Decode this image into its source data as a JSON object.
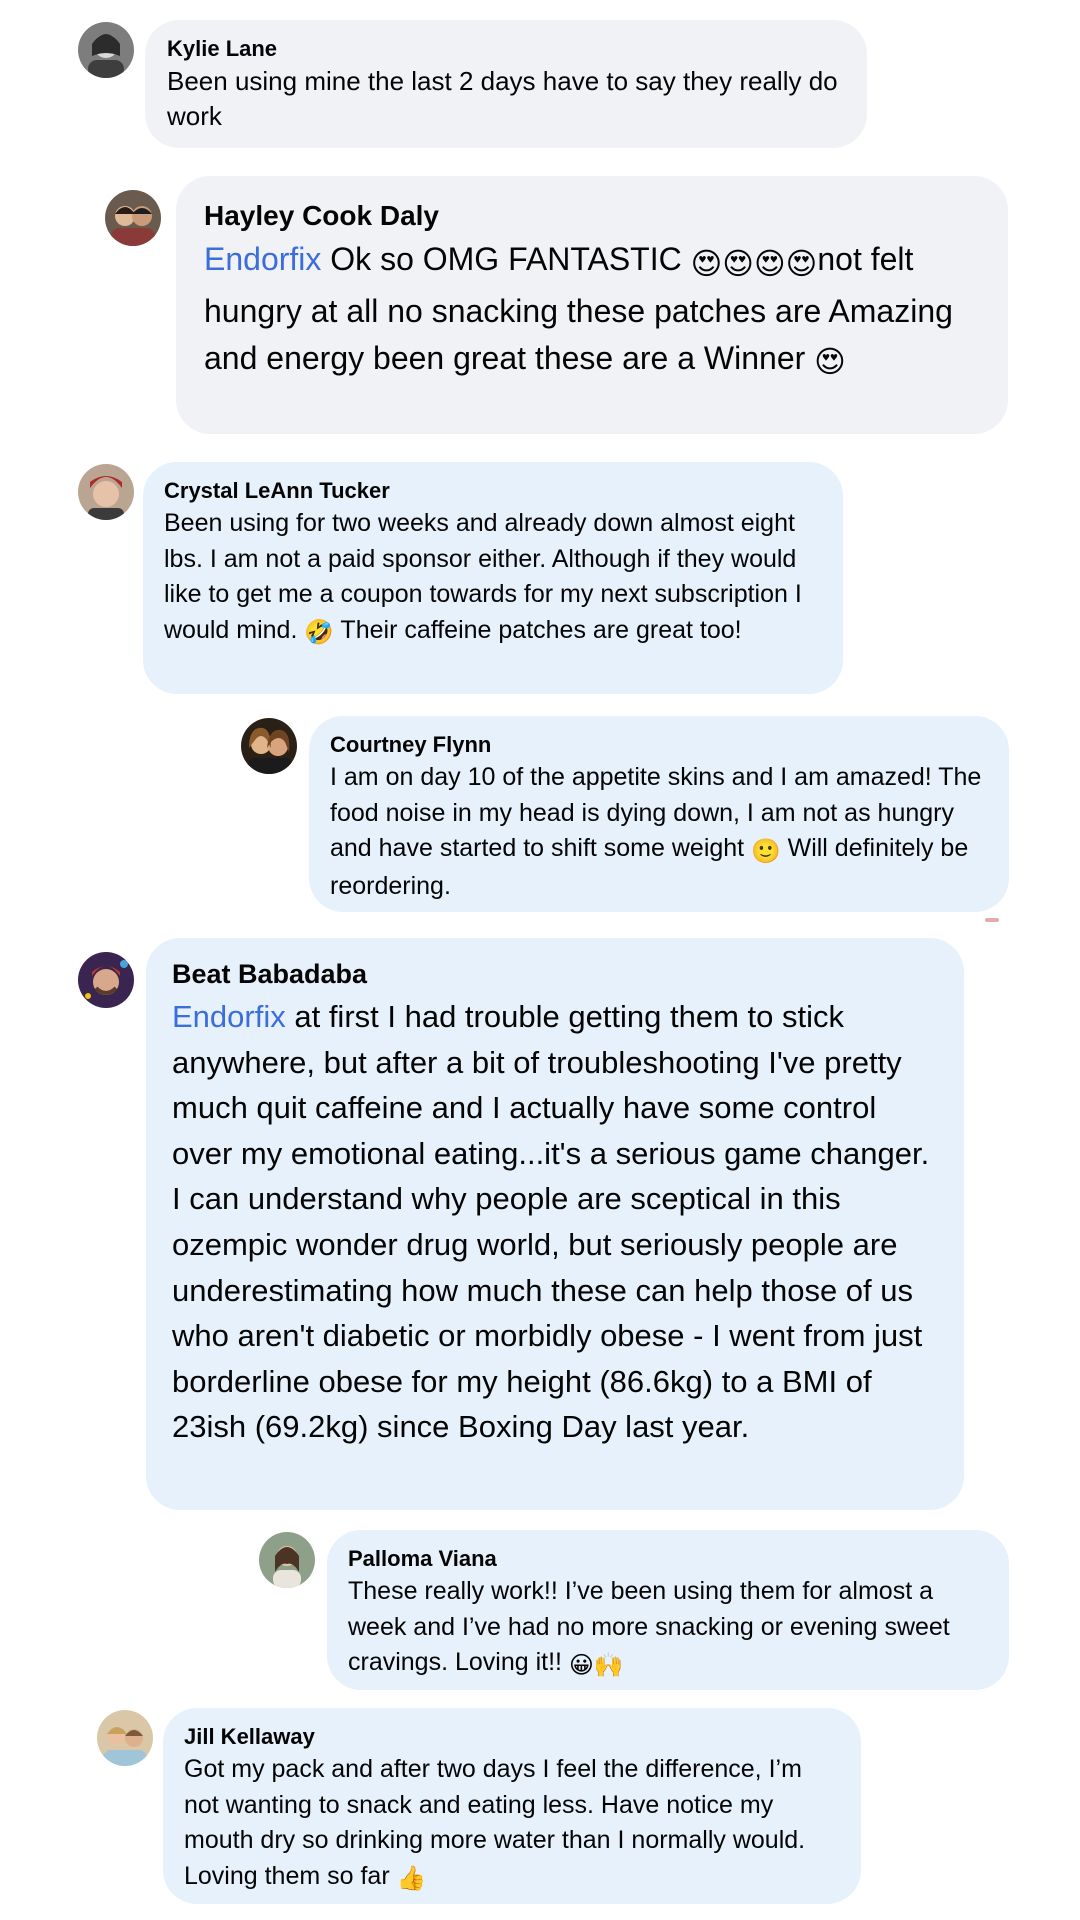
{
  "comments": [
    {
      "author": "Kylie Lane",
      "text": "Been using mine the last 2 days have to say they really do work"
    },
    {
      "author": "Hayley Cook Daly",
      "mention": "Endorfix",
      "text_a": " Ok so OMG FANTASTIC ",
      "emoji_a": "😍😍😍😍",
      "text_b": "not felt hungry at all no snacking these patches are Amazing and energy been great these are a Winner ",
      "emoji_b": "😍"
    },
    {
      "author": "Crystal LeAnn Tucker",
      "text_a": "Been using for two weeks and already down almost eight lbs. I am not a paid sponsor either. Although if they would like to get me a coupon towards for my next subscription I would mind. ",
      "emoji_a": "🤣",
      "text_b": " Their caffeine patches are great too!"
    },
    {
      "author": "Courtney Flynn",
      "text_a": "I am on day 10 of the appetite skins and I am amazed! The food noise in my head is dying down, I am not as hungry and have started to shift some weight ",
      "emoji_a": "🙂",
      "text_b": " Will definitely be reordering."
    },
    {
      "author": "Beat Babadaba",
      "mention": "Endorfix",
      "text": " at first I had trouble getting them to stick anywhere, but after a bit of troubleshooting I've pretty much quit caffeine and I actually have some control over my emotional eating...it's a serious game changer. I can understand why people are sceptical in this ozempic wonder drug world, but seriously people are underestimating how much these can help those of us who aren't diabetic or morbidly obese - I went from just borderline obese for my height (86.6kg) to a BMI of 23ish (69.2kg) since Boxing Day last year."
    },
    {
      "author": "Palloma Viana",
      "text_a": "These really work!! I’ve been using them for almost a week and I’ve had no more snacking or evening sweet cravings. Loving it!! ",
      "emoji_a": "😀🙌"
    },
    {
      "author": "Jill Kellaway",
      "text_a": "Got my pack and after two days I feel the difference, I’m not wanting to snack and eating less. Have notice my mouth dry so drinking more water than I normally would. Loving them so far ",
      "emoji_a": "👍"
    }
  ]
}
